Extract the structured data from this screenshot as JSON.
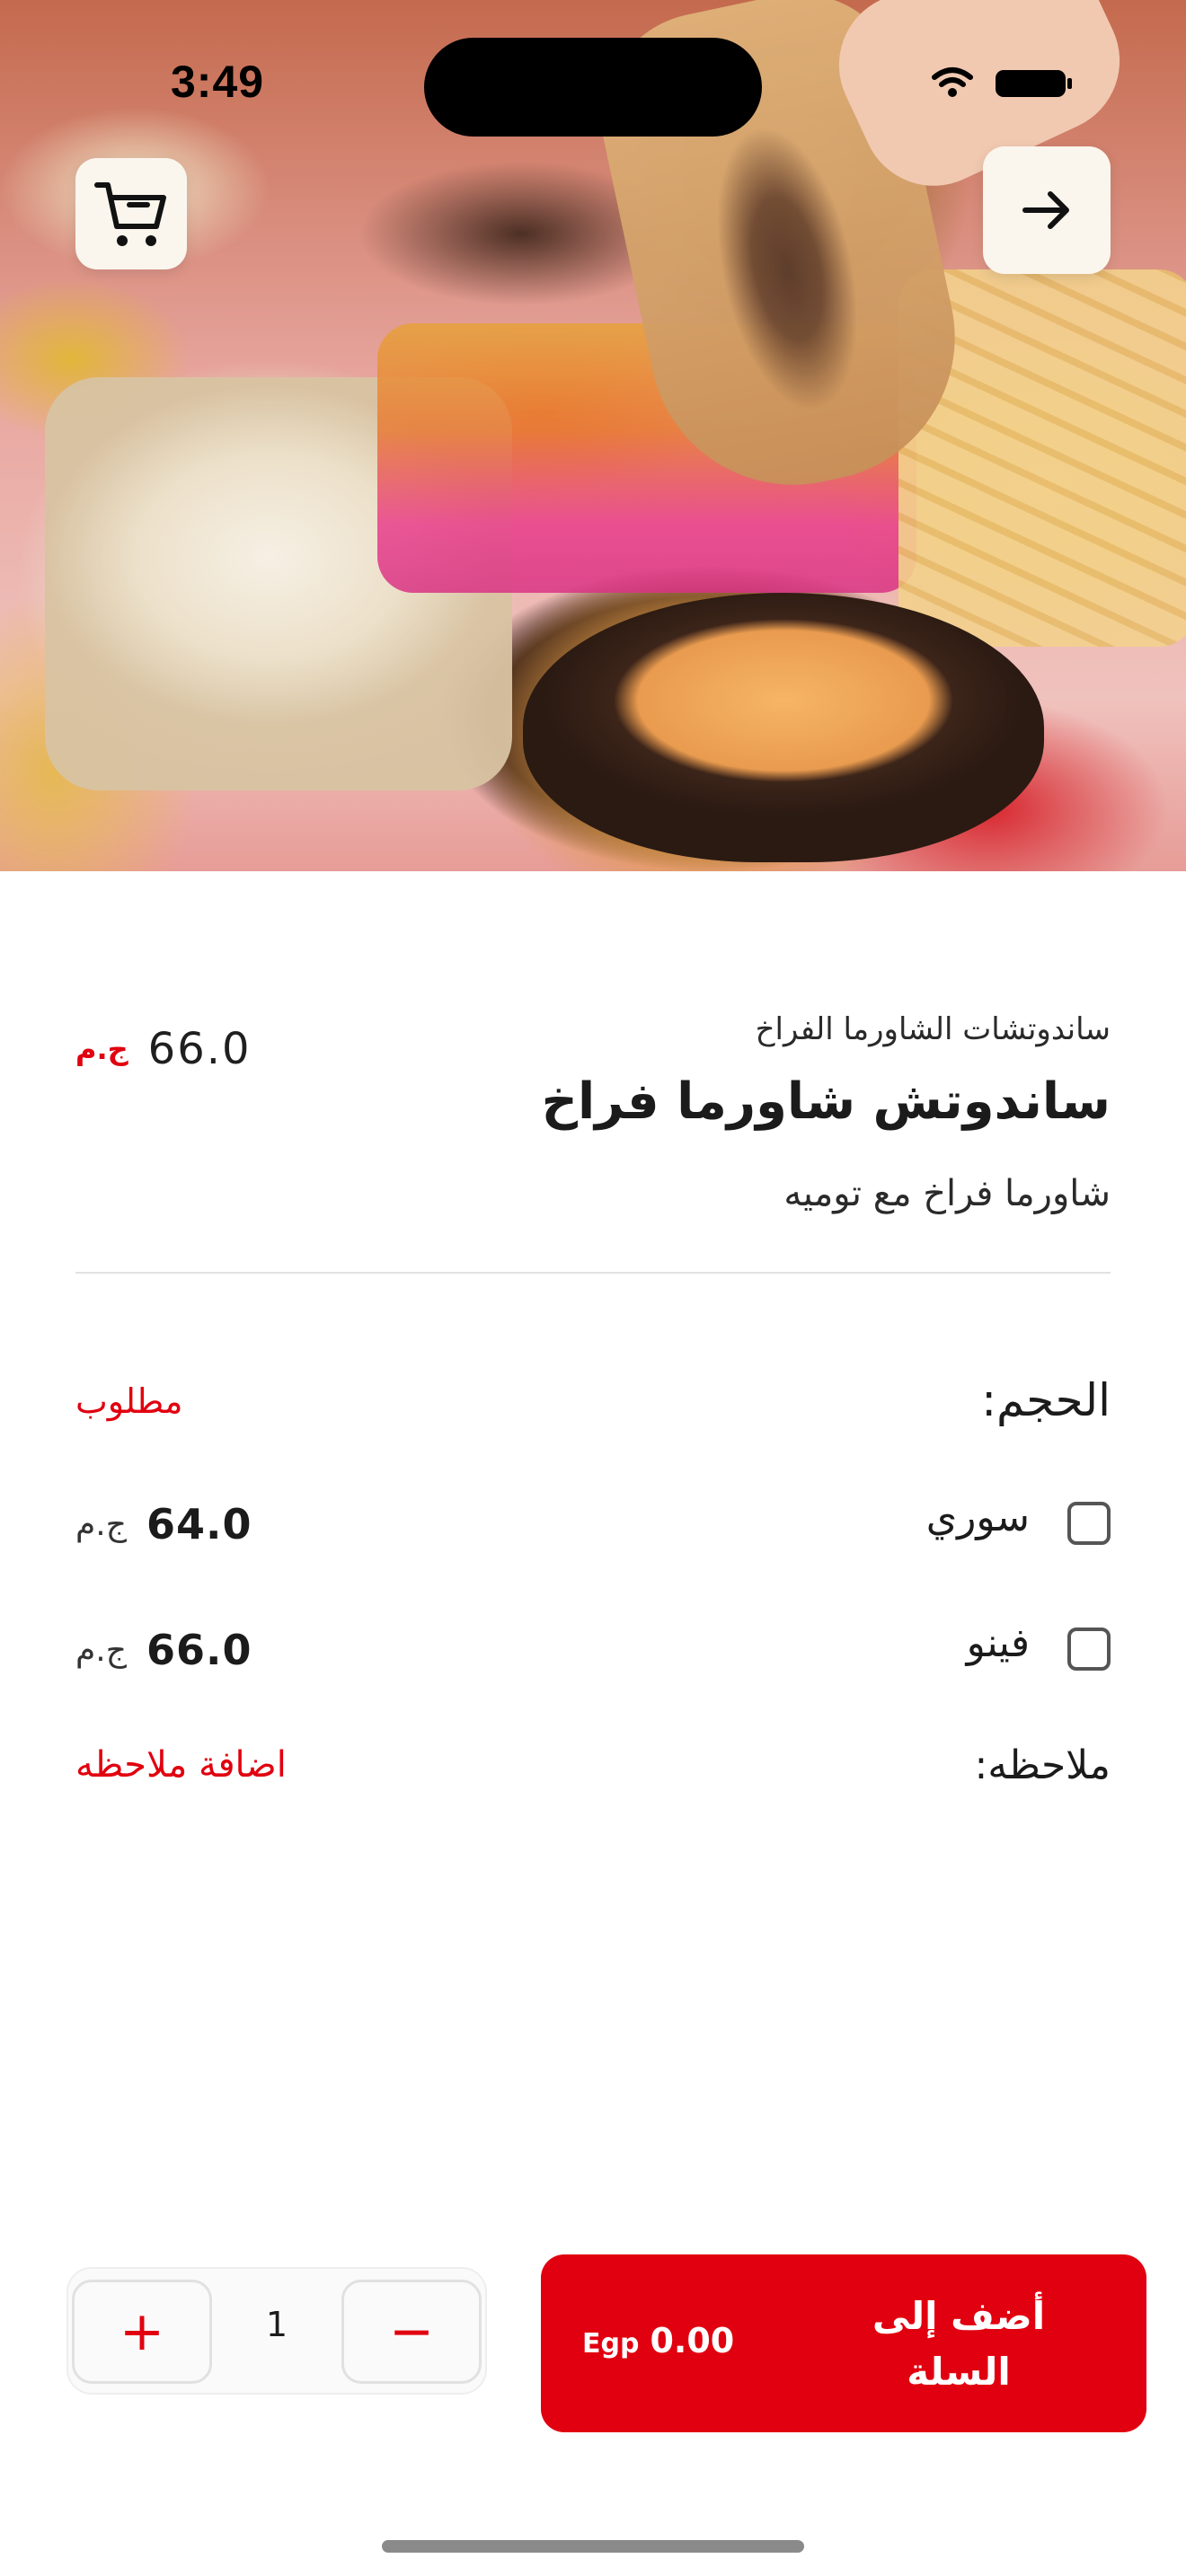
{
  "status_bar": {
    "time": "3:49"
  },
  "icons": {
    "cart": "shopping-cart-icon",
    "back": "arrow-right-icon",
    "wifi": "wifi-icon",
    "battery": "battery-icon"
  },
  "product": {
    "category": "ساندوتشات الشاورما الفراخ",
    "title": "ساندوتش شاورما فراخ",
    "description": "شاورما فراخ مع توميه",
    "price": "66.0",
    "currency": "ج.م"
  },
  "size": {
    "title": "الحجم:",
    "required_label": "مطلوب",
    "options": [
      {
        "name": "سوري",
        "price": "64.0",
        "currency": "ج.م",
        "checked": false
      },
      {
        "name": "فينو",
        "price": "66.0",
        "currency": "ج.م",
        "checked": false
      }
    ]
  },
  "note": {
    "title": "ملاحظه:",
    "add_label": "اضافة ملاحظه"
  },
  "quantity": {
    "value": "1",
    "plus": "+",
    "minus": "−"
  },
  "add_to_cart": {
    "label": "أضف إلى السلة",
    "price": "0.00",
    "currency": "Egp"
  },
  "colors": {
    "accent": "#e1000f",
    "text": "#1b1b1b"
  }
}
